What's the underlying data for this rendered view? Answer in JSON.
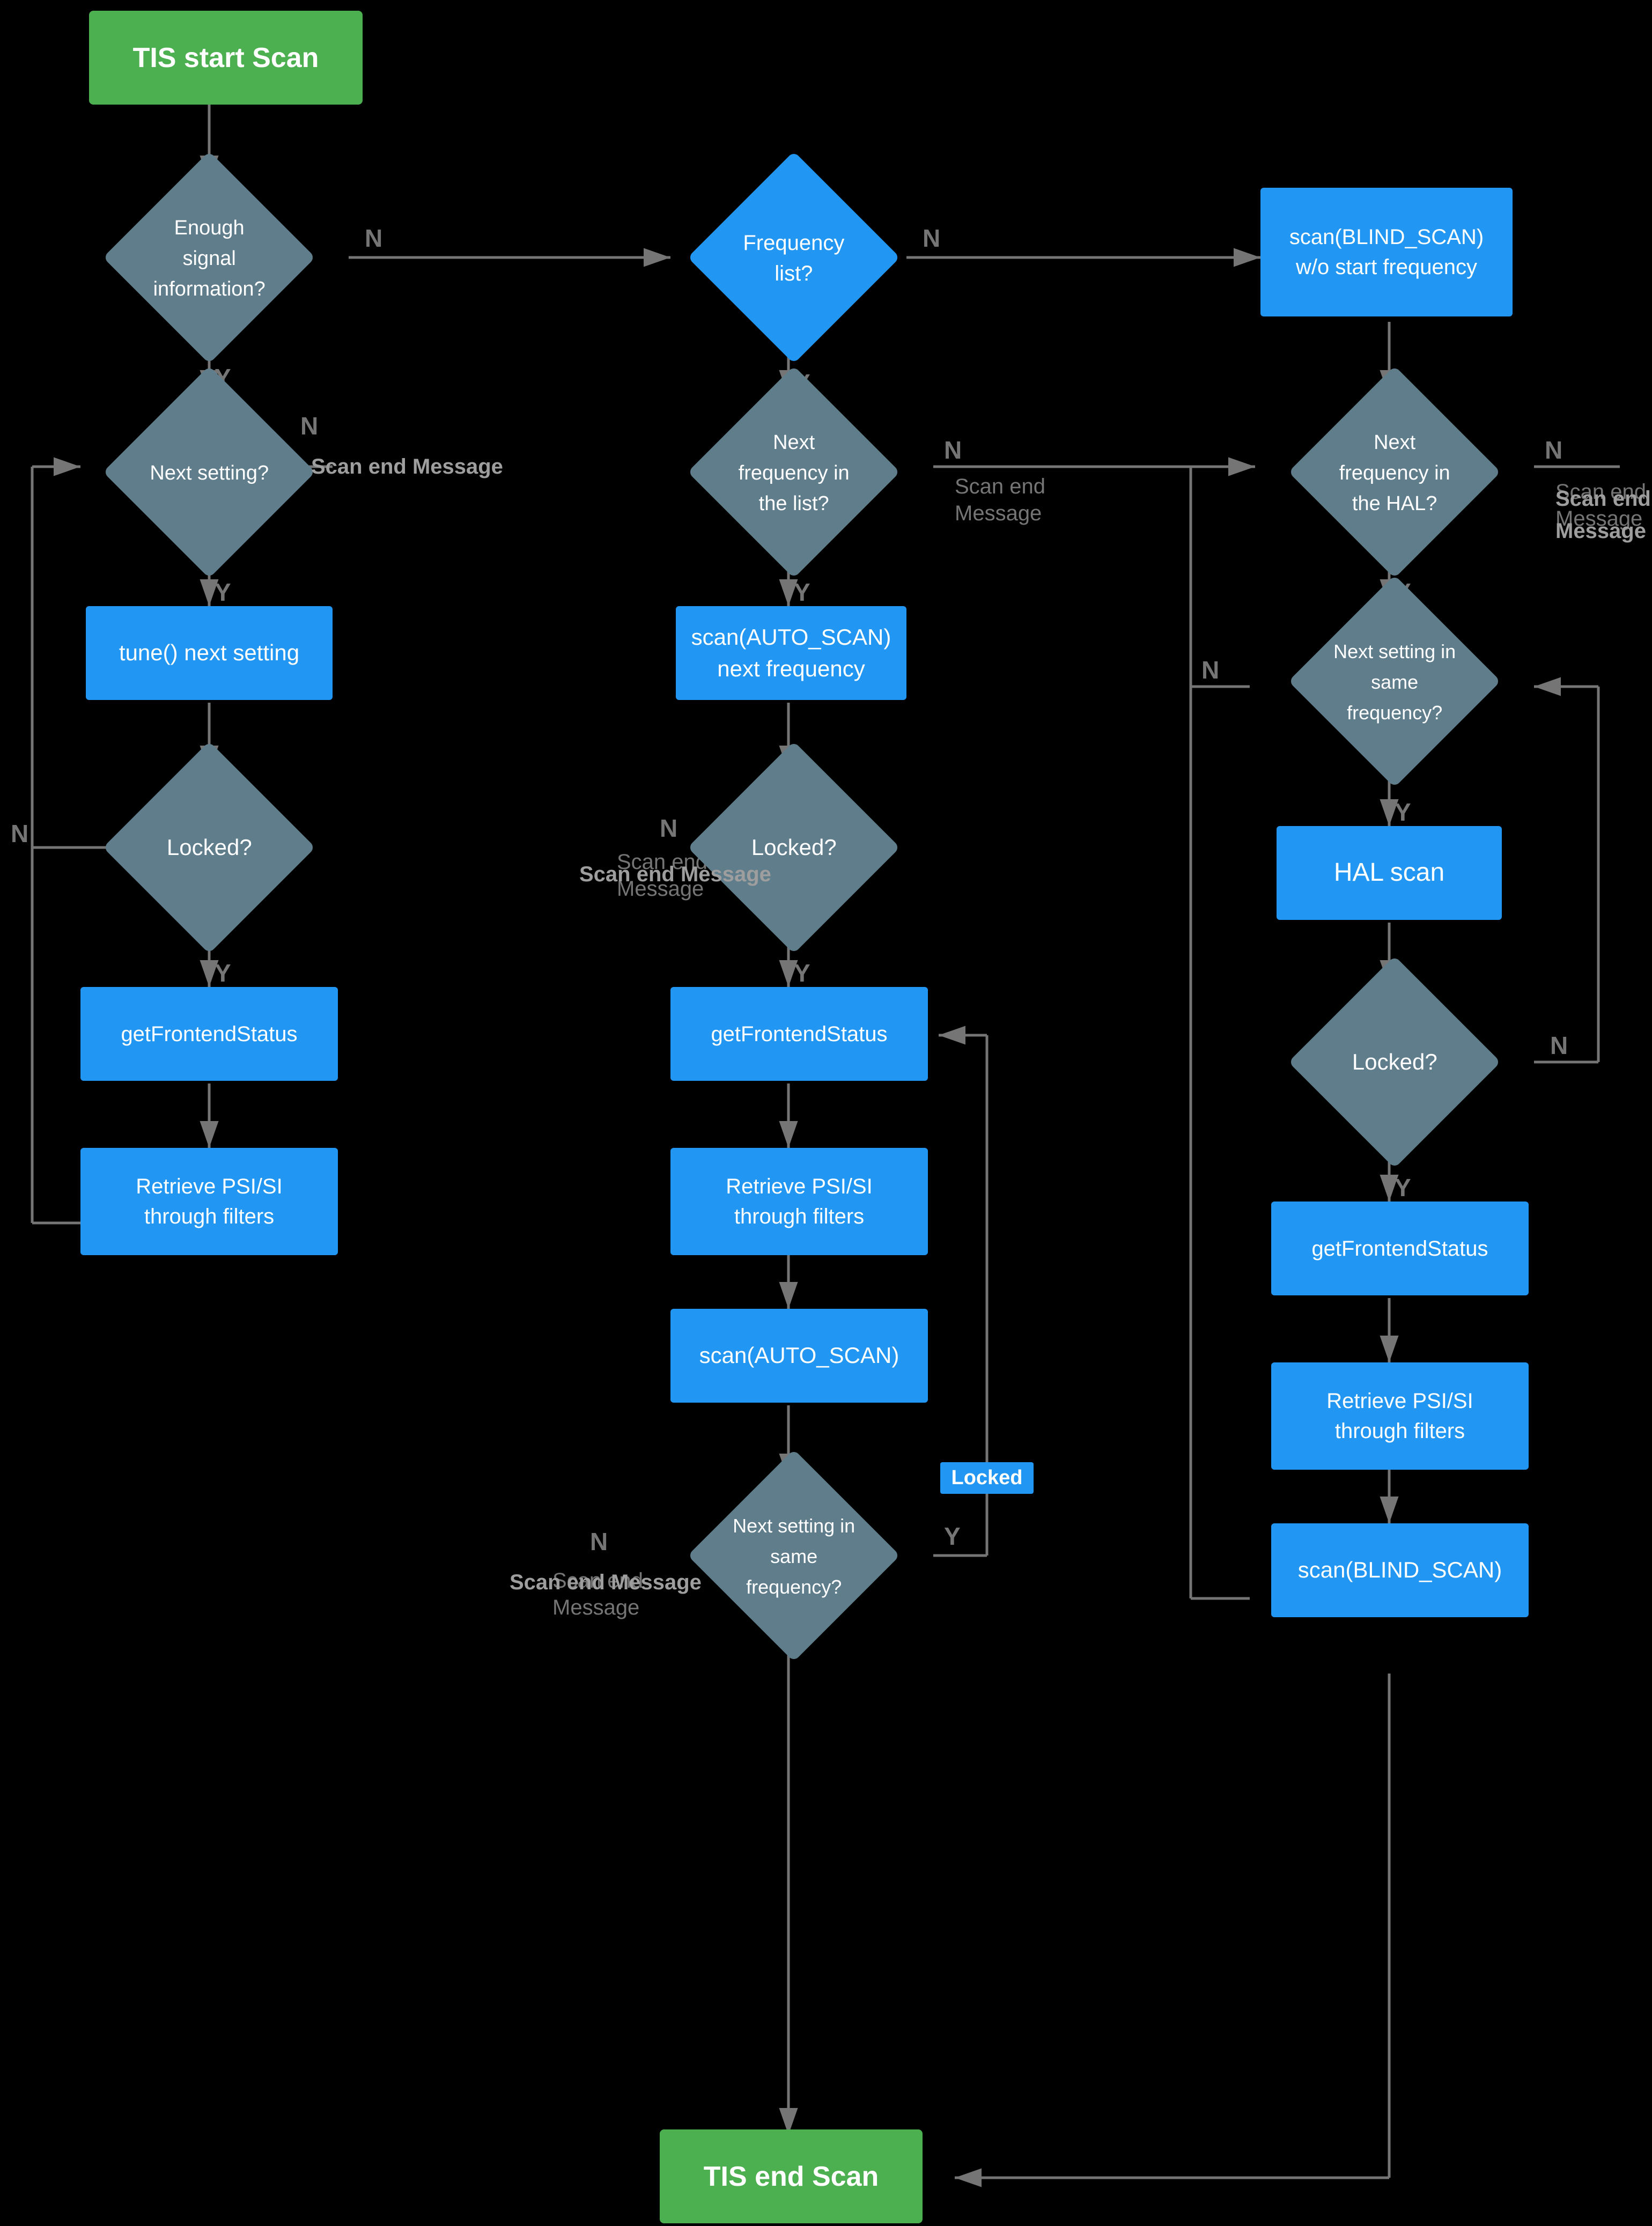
{
  "nodes": {
    "start": {
      "label": "TIS start Scan"
    },
    "end": {
      "label": "TIS end Scan"
    },
    "enough_signal": {
      "label": "Enough signal\ninformation?"
    },
    "frequency_list": {
      "label": "Frequency\nlist?"
    },
    "blind_scan_wo_start": {
      "label": "scan(BLIND_SCAN)\nw/o start frequency"
    },
    "next_setting": {
      "label": "Next setting?"
    },
    "next_freq_list": {
      "label": "Next frequency\nin the list?"
    },
    "next_freq_hal": {
      "label": "Next frequency\nin the HAL?"
    },
    "tune_next": {
      "label": "tune() next setting"
    },
    "scan_auto_next": {
      "label": "scan(AUTO_SCAN)\nnext frequency"
    },
    "next_setting_same_freq_hal": {
      "label": "Next setting in\nsame frequency?"
    },
    "locked1": {
      "label": "Locked?"
    },
    "locked2": {
      "label": "Locked?"
    },
    "hal_scan": {
      "label": "HAL scan"
    },
    "locked3": {
      "label": "Locked?"
    },
    "get_frontend1": {
      "label": "getFrontendStatus"
    },
    "get_frontend2": {
      "label": "getFrontendStatus"
    },
    "get_frontend3": {
      "label": "getFrontendStatus"
    },
    "retrieve_psi1": {
      "label": "Retrieve PSI/SI\nthrough filters"
    },
    "retrieve_psi2": {
      "label": "Retrieve PSI/SI\nthrough filters"
    },
    "retrieve_psi3": {
      "label": "Retrieve PSI/SI\nthrough filters"
    },
    "scan_auto2": {
      "label": "scan(AUTO_SCAN)"
    },
    "scan_blind2": {
      "label": "scan(BLIND_SCAN)"
    },
    "next_setting_same_freq2": {
      "label": "Next setting in\nsame frequency?"
    },
    "locked_badge": {
      "label": "Locked"
    },
    "scan_end_msg1": {
      "label": "Scan end\nMessage"
    },
    "scan_end_msg2": {
      "label": "Scan end\nMessage"
    },
    "scan_end_msg3": {
      "label": "Scan end\nMessage"
    },
    "scan_end_msg4": {
      "label": "Scan end\nMessage"
    }
  },
  "labels": {
    "n": "N",
    "y": "Y"
  }
}
